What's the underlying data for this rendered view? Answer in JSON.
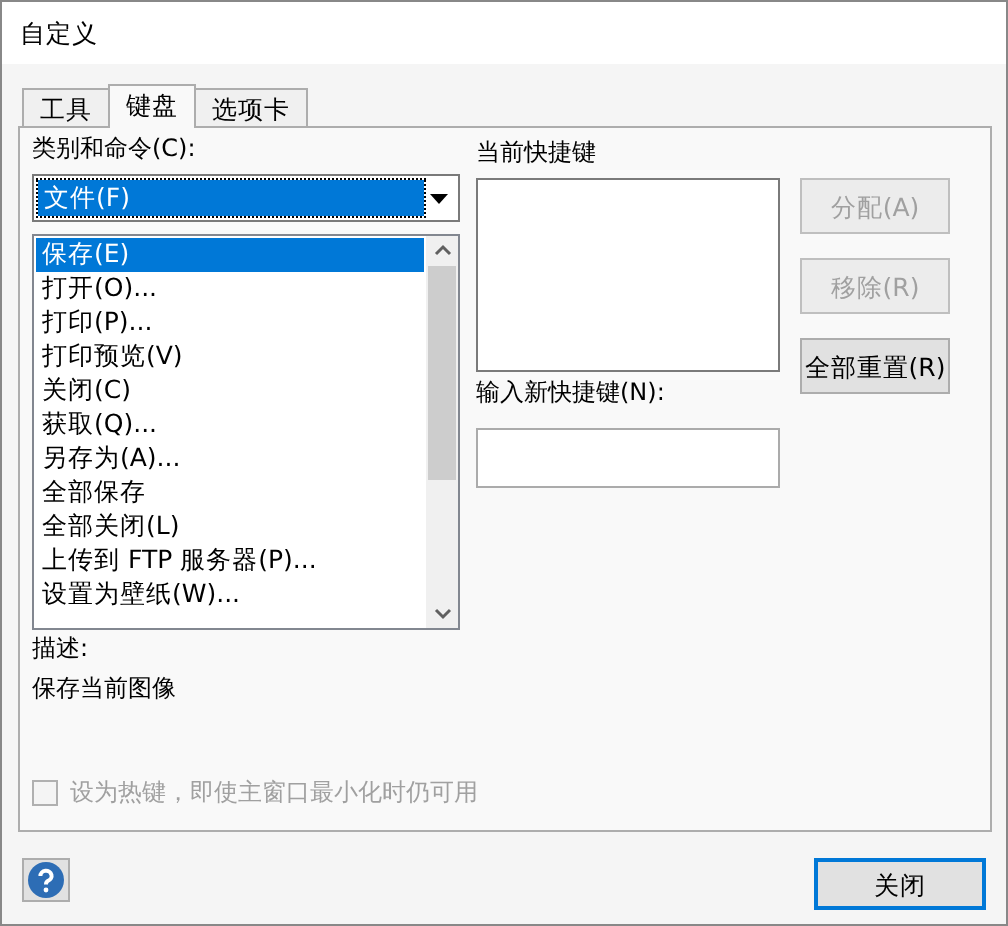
{
  "window": {
    "title": "自定义"
  },
  "tabs": [
    {
      "label": "工具",
      "selected": false
    },
    {
      "label": "键盘",
      "selected": true
    },
    {
      "label": "选项卡",
      "selected": false
    }
  ],
  "categories": {
    "label": "类别和命令(C):",
    "value": "文件(F)"
  },
  "commands": [
    {
      "label": "保存(E)",
      "selected": true
    },
    {
      "label": "打开(O)...",
      "selected": false
    },
    {
      "label": "打印(P)...",
      "selected": false
    },
    {
      "label": "打印预览(V)",
      "selected": false
    },
    {
      "label": "关闭(C)",
      "selected": false
    },
    {
      "label": "获取(Q)...",
      "selected": false
    },
    {
      "label": "另存为(A)...",
      "selected": false
    },
    {
      "label": "全部保存",
      "selected": false
    },
    {
      "label": "全部关闭(L)",
      "selected": false
    },
    {
      "label": "上传到 FTP 服务器(P)...",
      "selected": false
    },
    {
      "label": "设置为壁纸(W)...",
      "selected": false
    }
  ],
  "current_keys": {
    "label": "当前快捷键"
  },
  "new_key": {
    "label": "输入新快捷键(N):"
  },
  "side_buttons": [
    {
      "label": "分配(A)",
      "disabled": true
    },
    {
      "label": "移除(R)",
      "disabled": true
    },
    {
      "label": "全部重置(R)",
      "disabled": false
    }
  ],
  "description": {
    "label": "描述:",
    "text": "保存当前图像"
  },
  "hotkey": {
    "label": "设为热键，即使主窗口最小化时仍可用",
    "checked": false,
    "disabled": true
  },
  "footer": {
    "close": "关闭"
  }
}
